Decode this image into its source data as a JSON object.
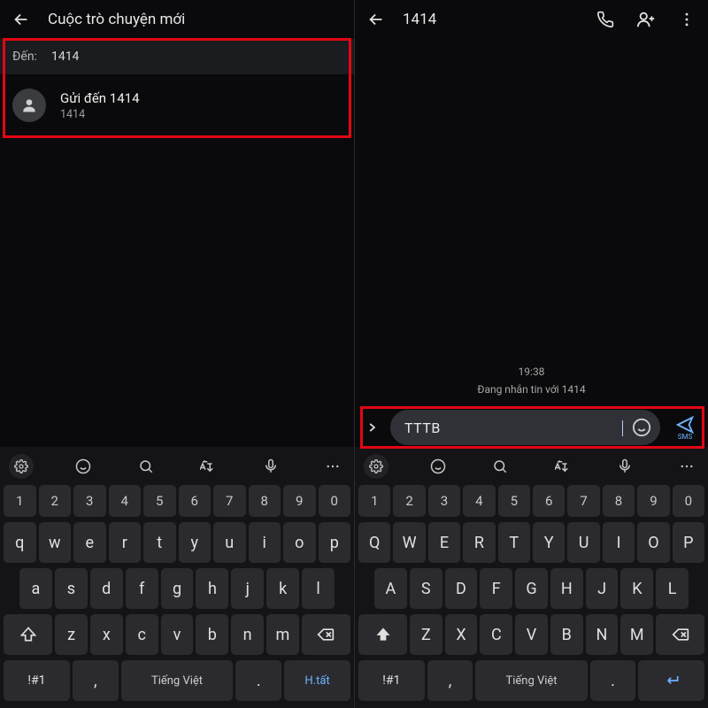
{
  "left": {
    "title": "Cuộc trò chuyện mới",
    "to_label": "Đến:",
    "to_value": "1414",
    "suggestion": {
      "line1": "Gửi đến 1414",
      "line2": "1414"
    }
  },
  "right": {
    "title": "1414",
    "timestamp": "19:38",
    "notice": "Đang nhắn tin với 1414",
    "compose_text": "TTTB",
    "send_label": "SMS"
  },
  "keyboard": {
    "digits": [
      "1",
      "2",
      "3",
      "4",
      "5",
      "6",
      "7",
      "8",
      "9",
      "0"
    ],
    "row1": [
      "q",
      "w",
      "e",
      "r",
      "t",
      "y",
      "u",
      "i",
      "o",
      "p"
    ],
    "row2": [
      "a",
      "s",
      "d",
      "f",
      "g",
      "h",
      "j",
      "k",
      "l"
    ],
    "row3": [
      "z",
      "x",
      "c",
      "v",
      "b",
      "n",
      "m"
    ],
    "sym": "!#1",
    "comma": ",",
    "lang": "Tiếng Việt",
    "dot": ".",
    "done": "H.tất"
  }
}
